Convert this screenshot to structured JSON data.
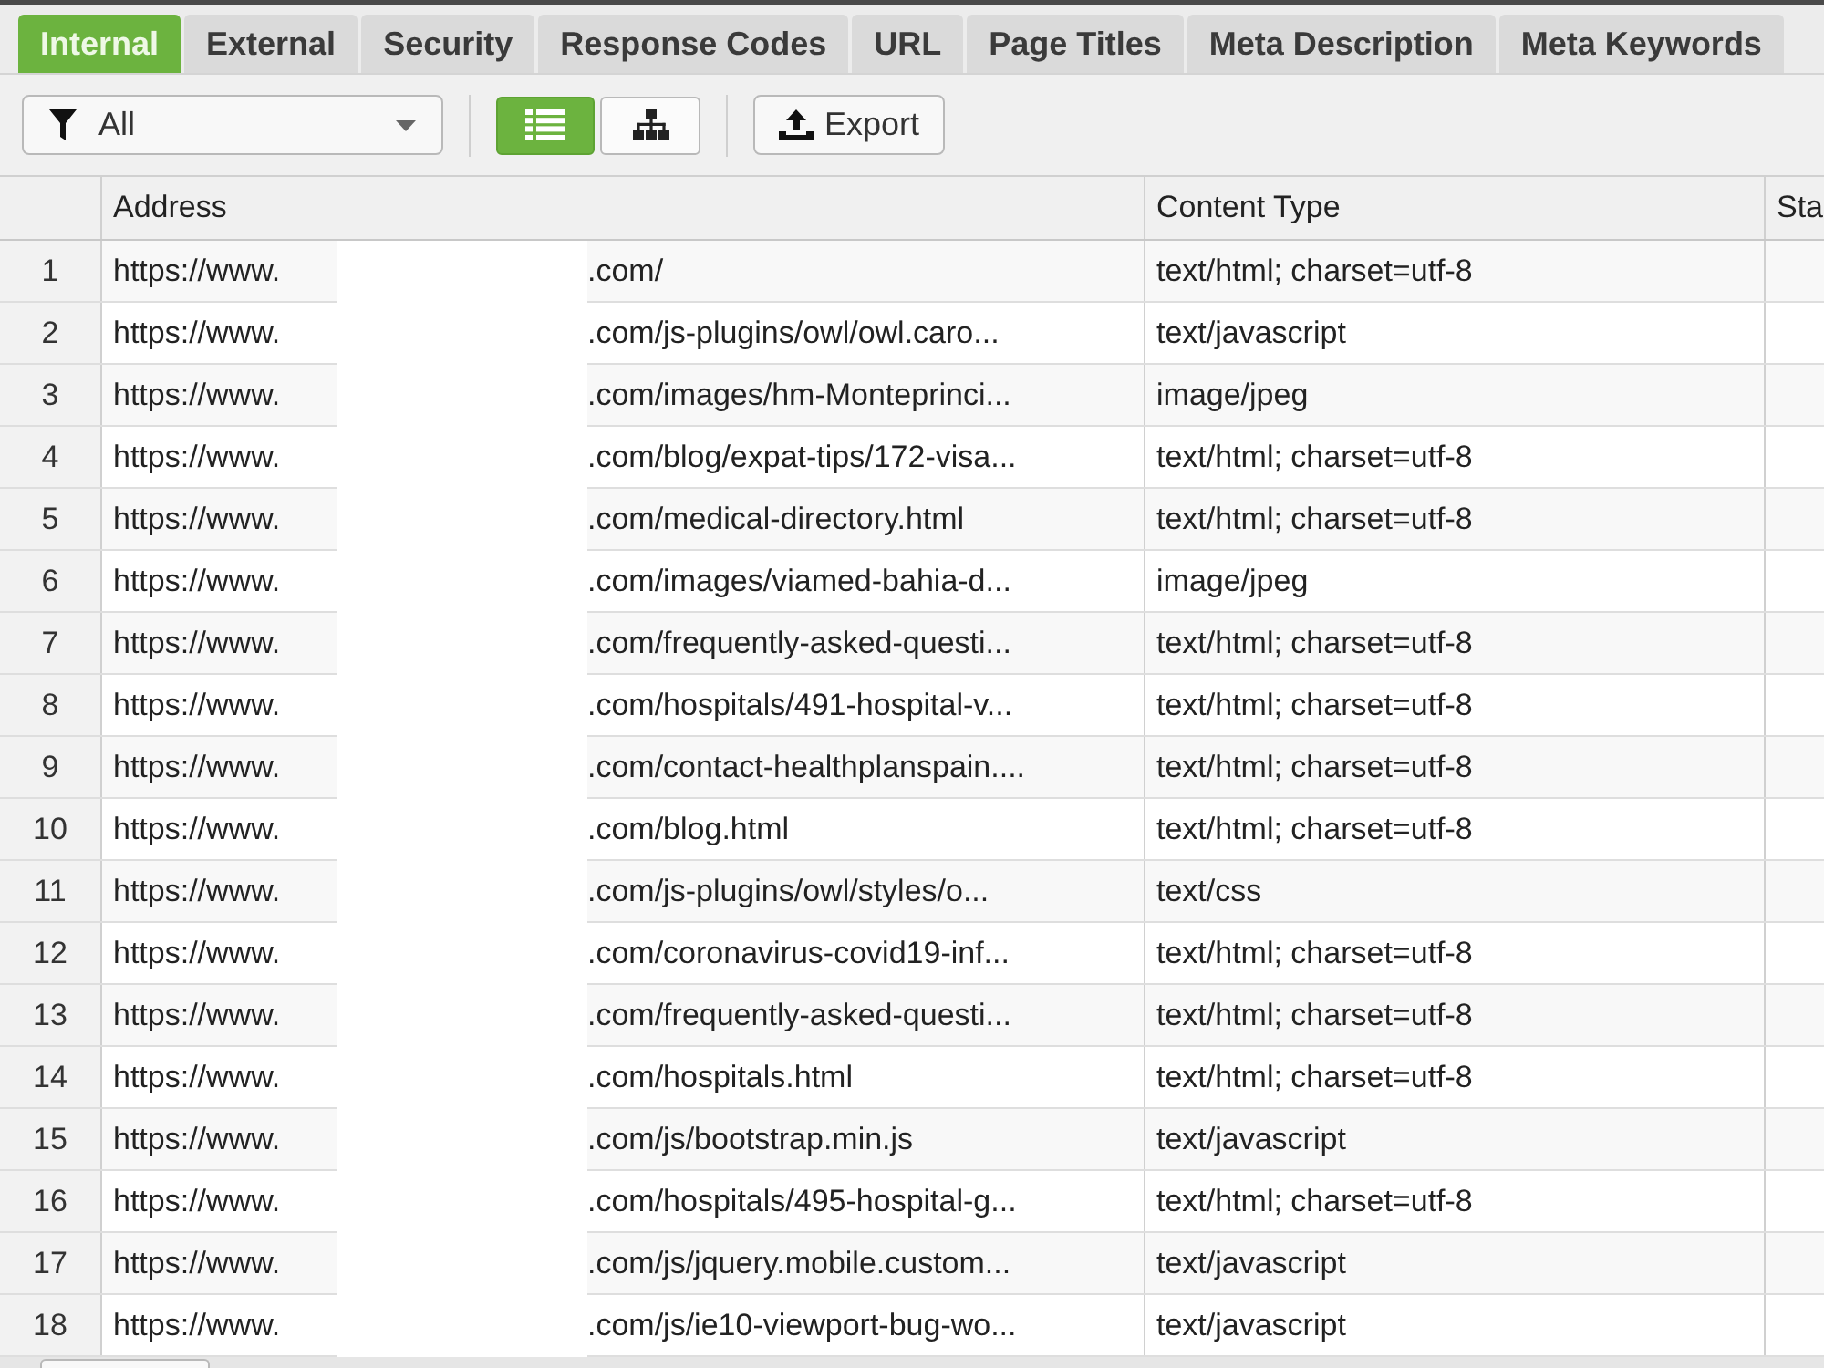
{
  "tabs": [
    {
      "label": "Internal",
      "selected": true
    },
    {
      "label": "External",
      "selected": false
    },
    {
      "label": "Security",
      "selected": false
    },
    {
      "label": "Response Codes",
      "selected": false
    },
    {
      "label": "URL",
      "selected": false
    },
    {
      "label": "Page Titles",
      "selected": false
    },
    {
      "label": "Meta Description",
      "selected": false
    },
    {
      "label": "Meta Keywords",
      "selected": false
    }
  ],
  "toolbar": {
    "filter": {
      "value": "All"
    },
    "view_buttons": [
      {
        "kind": "list",
        "selected": true
      },
      {
        "kind": "tree",
        "selected": false
      }
    ],
    "export_button": "Export"
  },
  "table": {
    "columns": [
      "Address",
      "Content Type",
      "Sta"
    ],
    "rows": [
      {
        "number": "1",
        "address_prefix": "https://www.",
        "address_path": ".com/",
        "content_type": "text/html; charset=utf-8",
        "selected": false
      },
      {
        "number": "2",
        "address_prefix": "https://www.",
        "address_path": ".com/js-plugins/owl/owl.caro...",
        "content_type": "text/javascript",
        "selected": false
      },
      {
        "number": "3",
        "address_prefix": "https://www.",
        "address_path": ".com/images/hm-Monteprinci...",
        "content_type": "image/jpeg",
        "selected": false
      },
      {
        "number": "4",
        "address_prefix": "https://www.",
        "address_path": ".com/blog/expat-tips/172-visa...",
        "content_type": "text/html; charset=utf-8",
        "selected": false
      },
      {
        "number": "5",
        "address_prefix": "https://www.",
        "address_path": ".com/medical-directory.html",
        "content_type": "text/html; charset=utf-8",
        "selected": false
      },
      {
        "number": "6",
        "address_prefix": "https://www.",
        "address_path": ".com/images/viamed-bahia-d...",
        "content_type": "image/jpeg",
        "selected": false
      },
      {
        "number": "7",
        "address_prefix": "https://www.",
        "address_path": ".com/frequently-asked-questi...",
        "content_type": "text/html; charset=utf-8",
        "selected": false
      },
      {
        "number": "8",
        "address_prefix": "https://www.",
        "address_path": ".com/hospitals/491-hospital-v...",
        "content_type": "text/html; charset=utf-8",
        "selected": false
      },
      {
        "number": "9",
        "address_prefix": "https://www.",
        "address_path": ".com/contact-healthplanspain....",
        "content_type": "text/html; charset=utf-8",
        "selected": false
      },
      {
        "number": "10",
        "address_prefix": "https://www.",
        "address_path": ".com/blog.html",
        "content_type": "text/html; charset=utf-8",
        "selected": false
      },
      {
        "number": "11",
        "address_prefix": "https://www.",
        "address_path": ".com/js-plugins/owl/styles/o...",
        "content_type": "text/css",
        "selected": false
      },
      {
        "number": "12",
        "address_prefix": "https://www.",
        "address_path": ".com/coronavirus-covid19-inf...",
        "content_type": "text/html; charset=utf-8",
        "selected": false
      },
      {
        "number": "13",
        "address_prefix": "https://www.",
        "address_path": ".com/frequently-asked-questi...",
        "content_type": "text/html; charset=utf-8",
        "selected": false
      },
      {
        "number": "14",
        "address_prefix": "https://www.",
        "address_path": ".com/hospitals.html",
        "content_type": "text/html; charset=utf-8",
        "selected": false
      },
      {
        "number": "15",
        "address_prefix": "https://www.",
        "address_path": ".com/js/bootstrap.min.js",
        "content_type": "text/javascript",
        "selected": false
      },
      {
        "number": "16",
        "address_prefix": "https://www.",
        "address_path": ".com/hospitals/495-hospital-g...",
        "content_type": "text/html; charset=utf-8",
        "selected": false
      },
      {
        "number": "17",
        "address_prefix": "https://www.",
        "address_path": ".com/js/jquery.mobile.custom...",
        "content_type": "text/javascript",
        "selected": false
      },
      {
        "number": "18",
        "address_prefix": "https://www.",
        "address_path": ".com/js/ie10-viewport-bug-wo...",
        "content_type": "text/javascript",
        "selected": false
      }
    ]
  }
}
